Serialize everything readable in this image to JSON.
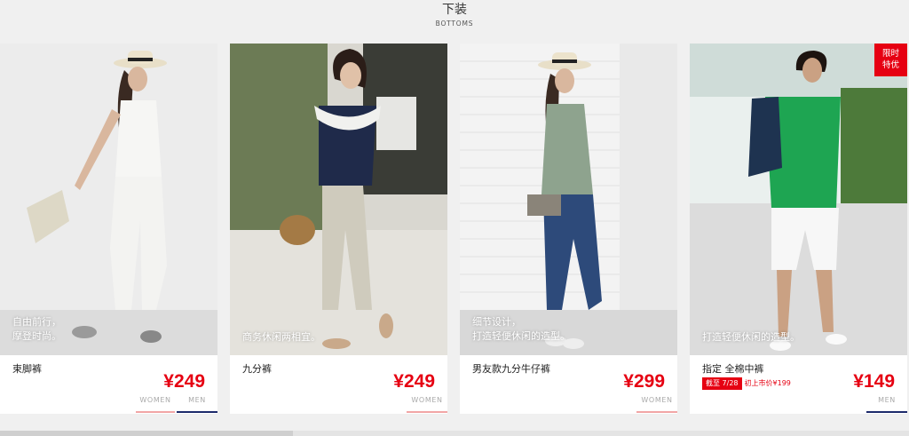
{
  "section": {
    "title": "下装",
    "subtitle": "BOTTOMS"
  },
  "products": [
    {
      "caption_lines": [
        "自由前行，",
        "摩登时尚。"
      ],
      "name": "束脚裤",
      "price": "¥249",
      "tabs": {
        "women": "WOMEN",
        "men": "MEN"
      },
      "limited": null,
      "promo": null
    },
    {
      "caption_lines": [
        "商务休闲两相宜。"
      ],
      "name": "九分裤",
      "price": "¥249",
      "tabs": {
        "women": "WOMEN"
      },
      "limited": null,
      "promo": null
    },
    {
      "caption_lines": [
        "细节设计，",
        "打造轻便休闲的造型。"
      ],
      "name": "男友款九分牛仔裤",
      "price": "¥299",
      "tabs": {
        "women": "WOMEN"
      },
      "limited": null,
      "promo": null
    },
    {
      "caption_lines": [
        "打造轻便休闲的造型。"
      ],
      "name": "指定 全棉中裤",
      "price": "¥149",
      "tabs": {
        "men": "MEN"
      },
      "limited": [
        "限时",
        "特优"
      ],
      "promo": {
        "tag": "截至 7/28",
        "original": "初上市价¥199"
      }
    }
  ],
  "colors": {
    "accent_red": "#e60012",
    "men_navy": "#1d2a6b",
    "women_pink": "#f2a6a6"
  }
}
